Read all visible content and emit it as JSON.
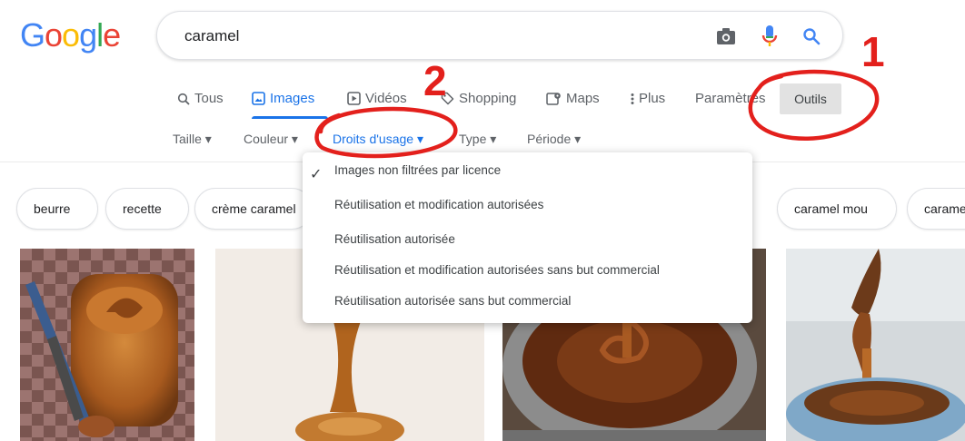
{
  "logo": {
    "text": "Google"
  },
  "search": {
    "query": "caramel"
  },
  "icons": [
    "camera-icon",
    "mic-icon",
    "search-icon",
    "check-icon"
  ],
  "colors": {
    "blue": "#4285f4",
    "red": "#ea4335",
    "yellow": "#fbbc05",
    "green": "#34a853",
    "active": "#1a73e8",
    "annotation": "#e3201c"
  },
  "nav": {
    "items": [
      {
        "label": "Tous",
        "icon": "search-icon"
      },
      {
        "label": "Images",
        "icon": "image-icon",
        "active": true
      },
      {
        "label": "Vidéos",
        "icon": "video-icon"
      },
      {
        "label": "Shopping",
        "icon": "tag-icon"
      },
      {
        "label": "Maps",
        "icon": "map-icon"
      },
      {
        "label": "Plus",
        "icon": "more-vert-icon"
      },
      {
        "label": "Paramètres"
      }
    ],
    "tools_label": "Outils"
  },
  "tools": [
    {
      "label": "Taille ▾"
    },
    {
      "label": "Couleur ▾"
    },
    {
      "label": "Droits d'usage ▾",
      "active": true
    },
    {
      "label": "Type ▾"
    },
    {
      "label": "Période ▾"
    }
  ],
  "chips": [
    "beurre",
    "recette",
    "crème caramel",
    "caramel mou",
    "caramel"
  ],
  "dropdown": {
    "selected_index": 0,
    "items": [
      "Images non filtrées par licence",
      "Réutilisation et modification autorisées",
      "Réutilisation autorisée",
      "Réutilisation et modification autorisées sans but commercial",
      "Réutilisation autorisée sans but commercial"
    ]
  },
  "annotations": {
    "one": "1",
    "two": "2"
  }
}
